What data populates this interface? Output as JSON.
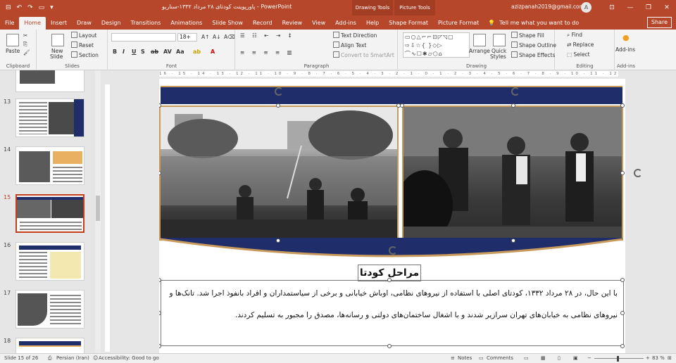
{
  "titlebar": {
    "doc_title": "پاورپوینت کودتای ۲۸ مرداد ۱۳۳۲-سناریو  -  PowerPoint",
    "context_tools": [
      "Drawing Tools",
      "Picture Tools"
    ],
    "user_email": "azizpanah2019@gmail.com",
    "avatar_initial": "A"
  },
  "tabs": [
    "File",
    "Home",
    "Insert",
    "Draw",
    "Design",
    "Transitions",
    "Animations",
    "Slide Show",
    "Record",
    "Review",
    "View",
    "Add-ins",
    "Help",
    "Shape Format",
    "Picture Format"
  ],
  "active_tab": "Home",
  "tell_me": "Tell me what you want to do",
  "share_label": "Share",
  "ribbon": {
    "clipboard": {
      "label": "Clipboard",
      "paste": "Paste"
    },
    "slides": {
      "label": "Slides",
      "new_slide": "New",
      "new_slide2": "Slide",
      "layout": "Layout",
      "reset": "Reset",
      "section": "Section"
    },
    "font": {
      "label": "Font",
      "size": "18+"
    },
    "paragraph": {
      "label": "Paragraph",
      "text_direction": "Text Direction",
      "align_text": "Align Text",
      "convert_smartart": "Convert to SmartArt"
    },
    "drawing": {
      "label": "Drawing",
      "arrange": "Arrange",
      "quick_styles": "Quick",
      "quick_styles2": "Styles",
      "shape_fill": "Shape Fill",
      "shape_outline": "Shape Outline",
      "shape_effects": "Shape Effects"
    },
    "editing": {
      "label": "Editing",
      "find": "Find",
      "replace": "Replace",
      "select": "Select"
    },
    "addins": {
      "label": "Add-ins",
      "addins": "Add-ins"
    }
  },
  "ruler_text": "16 · 15 · 14 · 13 · 12 · 11 · 10 · 9 · 8 · 7 · 6 · 5 · 4 · 3 · 2 · 1 · 0 · 1 · 2 · 3 · 4 · 5 · 6 · 7 · 8 · 9 · 10 · 11 · 12 · 13 · 14 · 15 · 16",
  "thumbnails": [
    {
      "num": "13"
    },
    {
      "num": "14"
    },
    {
      "num": "15"
    },
    {
      "num": "16"
    },
    {
      "num": "17"
    },
    {
      "num": "18"
    }
  ],
  "slide": {
    "title": "مراحل کودتا",
    "body": "با این حال، در ۲۸ مرداد ۱۳۳۲، کودتای اصلی با استفاده از نیروهای نظامی، اوباش خیابانی و برخی از سیاستمداران و افراد بانفوذ اجرا شد. تانک‌ها و نیروهای نظامی به خیابان‌های تهران سرازیر شدند و با اشغال ساختمان‌های دولتی و رسانه‌ها، مصدق را مجبور به تسلیم کردند."
  },
  "status": {
    "slide_info": "Slide 15 of 26",
    "language": "Persian (Iran)",
    "accessibility": "Accessibility: Good to go",
    "notes": "Notes",
    "comments": "Comments",
    "zoom": "83 %"
  },
  "colors": {
    "accent": "#b7472a",
    "navy": "#1f2d6b",
    "gold": "#c89a5c"
  }
}
